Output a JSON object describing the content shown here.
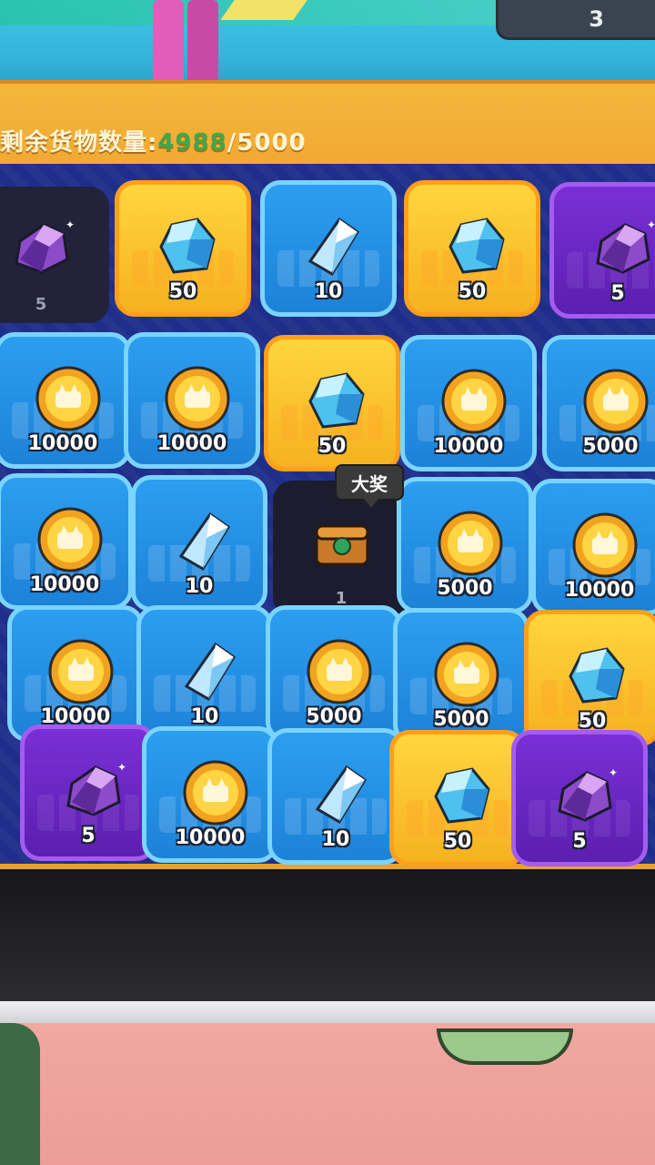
{
  "header": {
    "counter_value": "3",
    "remaining_label": "剩余货物数量:",
    "remaining_current": "4988",
    "remaining_total": "/5000"
  },
  "bubble": {
    "label": "大奖"
  },
  "tiles": [
    {
      "type": "gem_purple",
      "bg": "dark",
      "amount": "5"
    },
    {
      "type": "gem_blue",
      "bg": "gold",
      "amount": "50"
    },
    {
      "type": "crystal",
      "bg": "blue",
      "amount": "10"
    },
    {
      "type": "gem_blue",
      "bg": "gold",
      "amount": "50"
    },
    {
      "type": "gem_purple",
      "bg": "purple",
      "amount": "5"
    },
    {
      "type": "coin",
      "bg": "blue",
      "amount": "10000"
    },
    {
      "type": "coin",
      "bg": "blue",
      "amount": "10000"
    },
    {
      "type": "gem_blue",
      "bg": "gold",
      "amount": "50"
    },
    {
      "type": "coin",
      "bg": "blue",
      "amount": "10000"
    },
    {
      "type": "coin",
      "bg": "blue",
      "amount": "5000"
    },
    {
      "type": "coin",
      "bg": "blue",
      "amount": "10000"
    },
    {
      "type": "crystal",
      "bg": "blue",
      "amount": "10"
    },
    {
      "type": "chest",
      "bg": "empty",
      "amount": "1"
    },
    {
      "type": "coin",
      "bg": "blue",
      "amount": "5000"
    },
    {
      "type": "coin",
      "bg": "blue",
      "amount": "10000"
    },
    {
      "type": "coin",
      "bg": "blue",
      "amount": "10000"
    },
    {
      "type": "crystal",
      "bg": "blue",
      "amount": "10"
    },
    {
      "type": "coin",
      "bg": "blue",
      "amount": "5000"
    },
    {
      "type": "coin",
      "bg": "blue",
      "amount": "5000"
    },
    {
      "type": "gem_blue",
      "bg": "gold",
      "amount": "50"
    },
    {
      "type": "gem_purple",
      "bg": "purple",
      "amount": "5"
    },
    {
      "type": "coin",
      "bg": "blue",
      "amount": "10000"
    },
    {
      "type": "crystal",
      "bg": "blue",
      "amount": "10"
    },
    {
      "type": "gem_blue",
      "bg": "gold",
      "amount": "50"
    },
    {
      "type": "gem_purple",
      "bg": "purple",
      "amount": "5"
    }
  ],
  "colors": {
    "tile_blue": "#2c9ef0",
    "tile_gold": "#ffd53e",
    "tile_purple": "#7a2fd6",
    "frame": "#1f2e8a",
    "current_count": "#3fa84a"
  }
}
